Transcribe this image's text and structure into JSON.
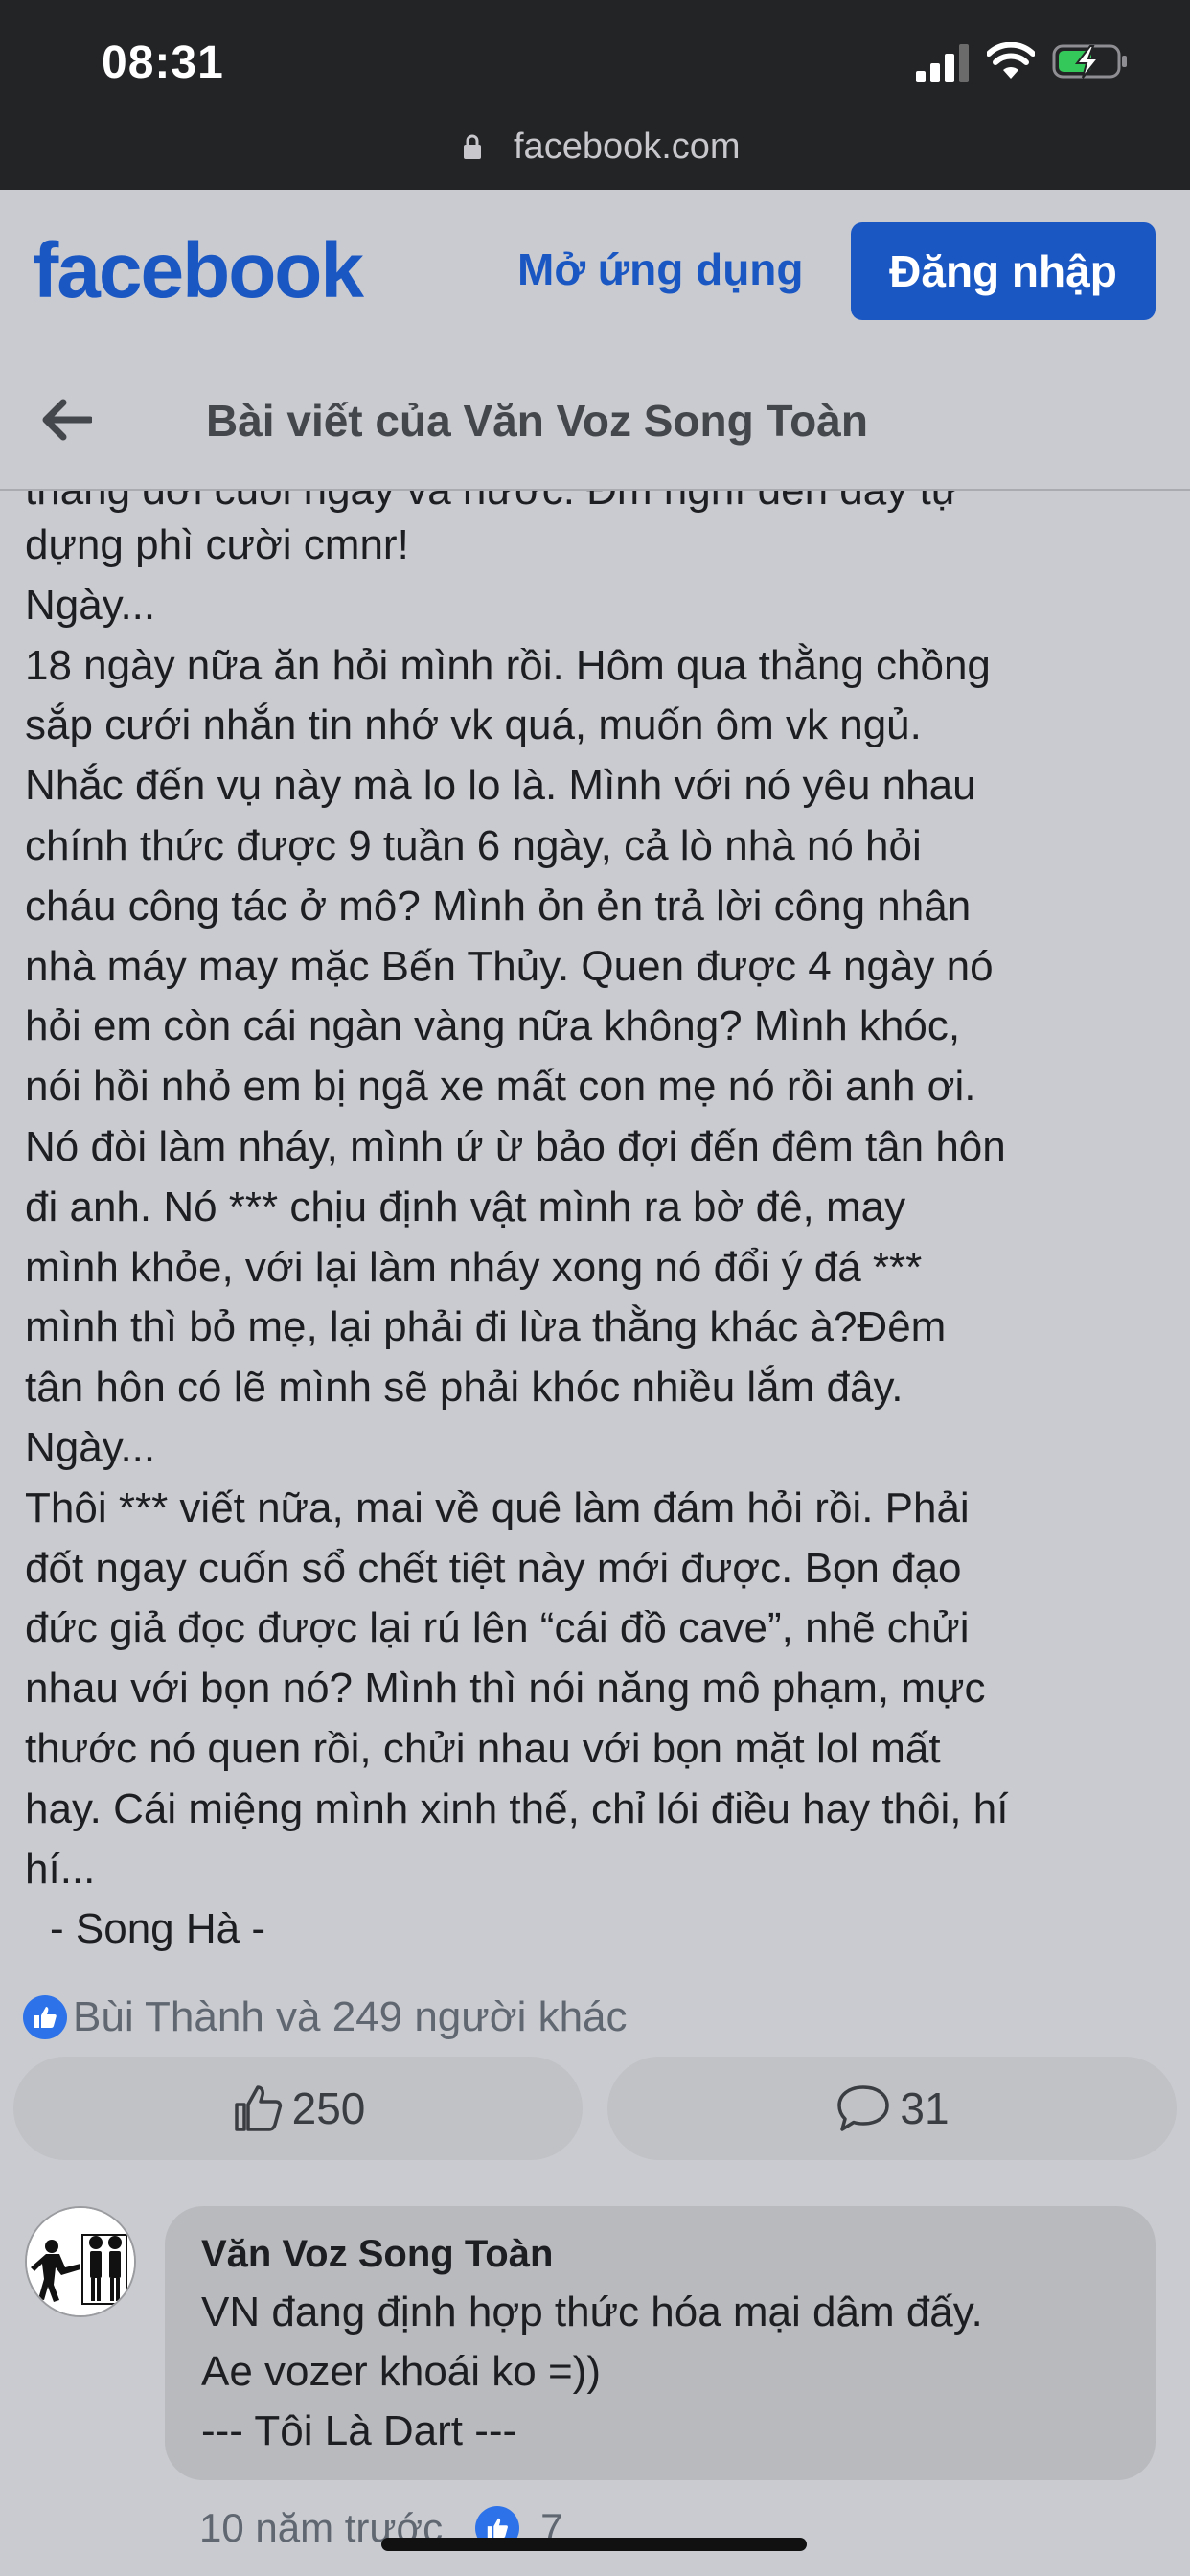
{
  "status_bar": {
    "time": "08:31"
  },
  "browser": {
    "url": "facebook.com"
  },
  "header": {
    "logo": "facebook",
    "open_app": "Mở ứng dụng",
    "login": "Đăng nhập"
  },
  "post_header": {
    "title": "Bài viết của Văn Voz Song Toàn"
  },
  "post": {
    "partial_top_line": "thằng đời cuối ngày và nước. Đm nghĩ đến đây tự",
    "lines": [
      "dựng phì cười cmnr!",
      "Ngày...",
      "18 ngày nữa ăn hỏi mình rồi. Hôm qua thằng chồng",
      "sắp cưới nhắn tin nhớ vk quá, muốn ôm vk ngủ.",
      "Nhắc đến vụ này mà lo lo là. Mình với nó yêu nhau",
      "chính thức được 9 tuần 6 ngày, cả lò nhà nó hỏi",
      "cháu công tác ở mô? Mình ỏn ẻn trả lời công nhân",
      "nhà máy may mặc Bến Thủy. Quen được 4 ngày nó",
      "hỏi em còn cái ngàn vàng nữa không? Mình khóc,",
      "nói hồi nhỏ em bị ngã xe mất con mẹ nó rồi anh ơi.",
      "Nó đòi làm nháy, mình ứ ừ bảo đợi đến đêm tân hôn",
      "đi anh. Nó *** chịu định vật mình ra bờ đê, may",
      "mình khỏe, với lại làm nháy xong nó đổi ý đá ***",
      "mình thì bỏ mẹ, lại phải đi lừa thằng khác à?Đêm",
      "tân hôn có lẽ mình sẽ phải khóc nhiều lắm đây.",
      "Ngày...",
      "Thôi *** viết nữa, mai về quê làm đám hỏi rồi. Phải",
      "đốt ngay cuốn sổ chết tiệt này mới được. Bọn đạo",
      "đức giả đọc được lại rú lên “cái đồ cave”, nhẽ chửi",
      "nhau với bọn nó? Mình thì nói năng mô phạm, mực",
      "thước nó quen rồi, chửi nhau với bọn mặt lol mất",
      "hay. Cái miệng mình xinh thế, chỉ lói điều hay thôi, hí",
      "hí..."
    ],
    "signature": "- Song Hà -"
  },
  "reactions": {
    "summary": "Bùi Thành và 249 người khác",
    "like_count": "250",
    "comment_count": "31"
  },
  "comment": {
    "author": "Văn Voz Song Toàn",
    "lines": [
      "VN đang định hợp thức hóa mại dâm đấy.",
      "Ae vozer khoái ko =))",
      "--- Tôi Là Dart ---"
    ],
    "time": "10 năm trước",
    "likes": "7"
  },
  "colors": {
    "brand": "#1b57c3",
    "background": "#c9cbd0",
    "status_bar": "#232425",
    "battery_charge": "#34c759"
  },
  "icons": [
    "signal-icon",
    "wifi-icon",
    "battery-charging-icon",
    "lock-icon",
    "back-arrow-icon",
    "like-icon",
    "comment-icon",
    "avatar-image"
  ]
}
